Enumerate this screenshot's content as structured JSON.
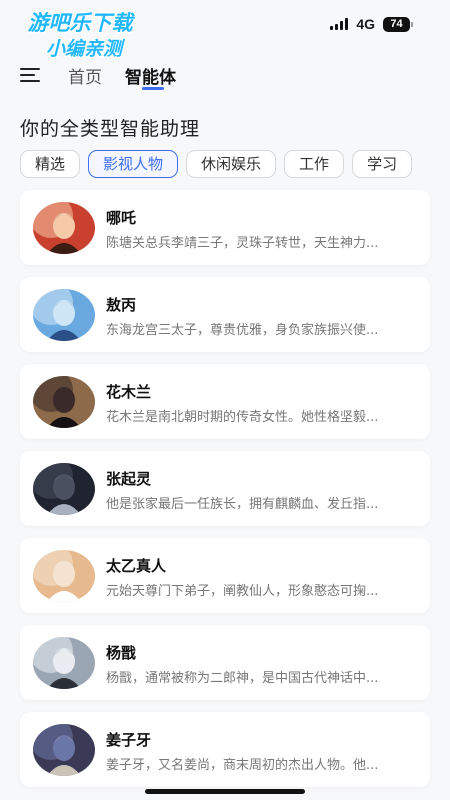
{
  "status_bar": {
    "watermark_line1": "游吧乐下载",
    "watermark_line2": "小编亲测",
    "network": "4G",
    "battery": "74"
  },
  "nav": {
    "home_label": "首页",
    "agent_label": "智能体",
    "accent_color": "#3d6ff0"
  },
  "page_title": "你的全类型智能助理",
  "categories": [
    "精选",
    "影视人物",
    "休闲娱乐",
    "工作",
    "学习"
  ],
  "active_category": "影视人物",
  "agents": [
    {
      "name": "哪吒",
      "desc": "陈塘关总兵李靖三子，灵珠子转世，天生神力...",
      "avatar": "nezha-avatar"
    },
    {
      "name": "敖丙",
      "desc": "东海龙宫三太子，尊贵优雅，身负家族振兴使...",
      "avatar": "aobing-avatar"
    },
    {
      "name": "花木兰",
      "desc": "花木兰是南北朝时期的传奇女性。她性格坚毅...",
      "avatar": "mulan-avatar"
    },
    {
      "name": "张起灵",
      "desc": "他是张家最后一任族长，拥有麒麟血、发丘指...",
      "avatar": "zhangqiling-avatar"
    },
    {
      "name": "太乙真人",
      "desc": "元始天尊门下弟子，阐教仙人，形象憨态可掬...",
      "avatar": "taiyi-avatar"
    },
    {
      "name": "杨戬",
      "desc": "杨戬，通常被称为二郎神，是中国古代神话中...",
      "avatar": "yangjian-avatar"
    },
    {
      "name": "姜子牙",
      "desc": "姜子牙，又名姜尚，商末周初的杰出人物。他...",
      "avatar": "jiangziya-avatar"
    }
  ]
}
